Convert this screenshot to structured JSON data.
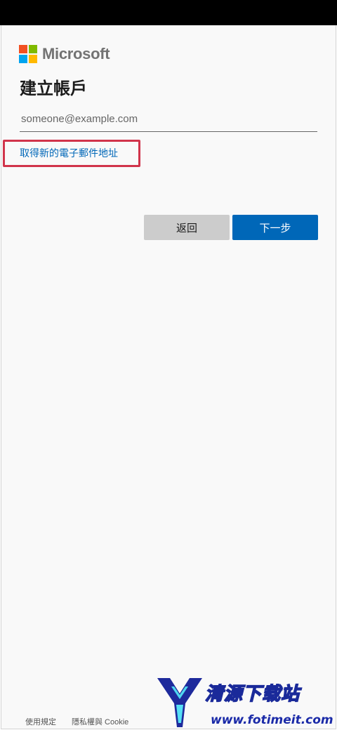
{
  "brand": {
    "name": "Microsoft",
    "colors": [
      "#f25022",
      "#7fba00",
      "#00a4ef",
      "#ffb900"
    ]
  },
  "page": {
    "title": "建立帳戶",
    "email_placeholder": "someone@example.com",
    "new_email_link": "取得新的電子郵件地址"
  },
  "buttons": {
    "back_label": "返回",
    "next_label": "下一步"
  },
  "footer": {
    "terms": "使用規定",
    "privacy": "隱私權與 Cookie"
  },
  "watermark": {
    "title": "清源下载站",
    "url": "www.fotimeit.com"
  },
  "colors": {
    "accent": "#0067b8",
    "highlight": "#d1344b"
  }
}
